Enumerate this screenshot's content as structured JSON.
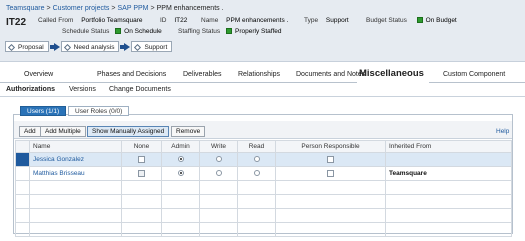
{
  "breadcrumb": {
    "items": [
      "Teamsquare",
      "Customer projects",
      "SAP PPM"
    ],
    "separator": ">",
    "current": "PPM enhancements ."
  },
  "item": {
    "id": "IT22",
    "called_from_label": "Called From",
    "called_from_value": "Portfolio Teamsquare",
    "id_label": "ID",
    "id_value": "IT22",
    "name_label": "Name",
    "name_value": "PPM enhancements .",
    "type_label": "Type",
    "type_value": "Support",
    "budget_status_label": "Budget Status",
    "budget_status_value": "On Budget",
    "schedule_status_label": "Schedule Status",
    "schedule_status_value": "On Schedule",
    "staffing_status_label": "Staffing Status",
    "staffing_status_value": "Properly Staffed",
    "status_color": "#2e9b2e"
  },
  "workflow": [
    "Proposal",
    "Need analysis",
    "Support"
  ],
  "tabs": [
    {
      "label": "Overview"
    },
    {
      "label": "Phases and Decisions"
    },
    {
      "label": "Deliverables"
    },
    {
      "label": "Relationships"
    },
    {
      "label": "Documents and Notes"
    },
    {
      "label": "Miscellaneous",
      "active": true
    },
    {
      "label": "Custom Component"
    }
  ],
  "subtabs": [
    {
      "label": "Authorizations",
      "active": true
    },
    {
      "label": "Versions"
    },
    {
      "label": "Change Documents"
    }
  ],
  "panel": {
    "tab_users": "Users (1/1)",
    "tab_roles": "User Roles (0/0)",
    "buttons": {
      "add": "Add",
      "add_multiple": "Add Multiple",
      "show_manually_assigned": "Show Manually Assigned",
      "remove": "Remove"
    },
    "help": "Help"
  },
  "grid": {
    "columns": [
      "Name",
      "None",
      "Admin",
      "Write",
      "Read",
      "Person Responsible",
      "Inherited From"
    ],
    "rows": [
      {
        "name": "Jessica Gonzalez",
        "inherited_from": "",
        "selected": true
      },
      {
        "name": "Matthias Brisseau",
        "inherited_from": "Teamsquare",
        "selected": false
      }
    ]
  },
  "colors": {
    "accent": "#2a73b8",
    "link": "#1f5a9e",
    "header_bg": "#e6ebf1"
  }
}
